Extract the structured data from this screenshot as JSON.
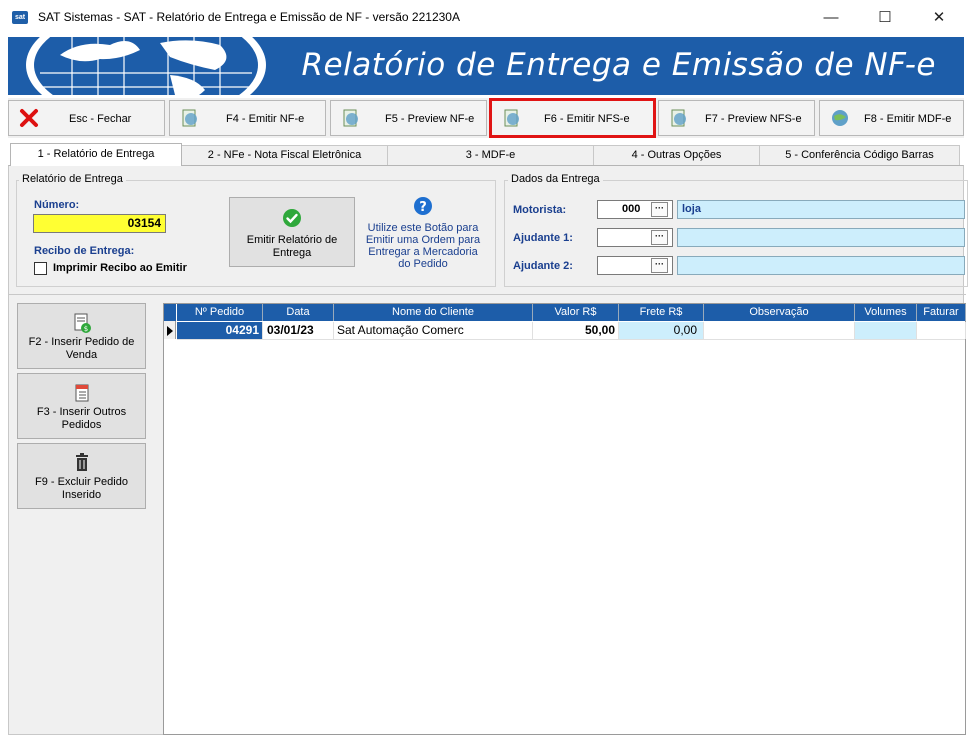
{
  "window": {
    "title": "SAT Sistemas - SAT - Relatório de Entrega e Emissão de NF - versão 221230A",
    "app_icon_text": "sat",
    "minimize": "—",
    "maximize": "☐",
    "close": "✕"
  },
  "banner": {
    "title": "Relatório de Entrega e Emissão de NF-e"
  },
  "toolbar": {
    "close": "Esc - Fechar",
    "emit_nfe": "F4 - Emitir NF-e",
    "preview_nfe": "F5 - Preview NF-e",
    "emit_nfse": "F6 - Emitir NFS-e",
    "preview_nfse": "F7 - Preview NFS-e",
    "emit_mdfe": "F8 - Emitir MDF-e"
  },
  "tabs": [
    "1 - Relatório de Entrega",
    "2 - NFe - Nota Fiscal Eletrônica",
    "3 - MDF-e",
    "4 - Outras Opções",
    "5 - Conferência Código Barras"
  ],
  "report": {
    "legend": "Relatório de Entrega",
    "number_label": "Número:",
    "number_value": "03154",
    "receipt_label": "Recibo de Entrega:",
    "print_receipt_label": "Imprimir Recibo ao Emitir",
    "emit_button_line1": "Emitir Relatório de",
    "emit_button_line2": "Entrega",
    "help_line1": "Utilize este Botão para",
    "help_line2": "Emitir uma Ordem para",
    "help_line3": "Entregar a Mercadoria",
    "help_line4": "do Pedido"
  },
  "delivery": {
    "legend": "Dados da Entrega",
    "driver_label": "Motorista:",
    "driver_code": "000",
    "driver_name": "loja",
    "helper1_label": "Ajudante 1:",
    "helper1_code": "",
    "helper1_name": "",
    "helper2_label": "Ajudante 2:",
    "helper2_code": "",
    "helper2_name": "",
    "dots": "···"
  },
  "side": {
    "insert_sale_line1": "F2 - Inserir Pedido de",
    "insert_sale_line2": "Venda",
    "insert_other_line1": "F3 - Inserir Outros",
    "insert_other_line2": "Pedidos",
    "delete_line1": "F9 - Excluir Pedido",
    "delete_line2": "Inserido"
  },
  "grid": {
    "columns": [
      "Nº Pedido",
      "Data",
      "Nome do Cliente",
      "Valor R$",
      "Frete R$",
      "Observação",
      "Volumes",
      "Faturar"
    ],
    "rows": [
      {
        "pedido": "04291",
        "data": "03/01/23",
        "cliente": "Sat Automação Comerc",
        "valor": "50,00",
        "frete": "0,00",
        "obs": "",
        "volumes": "",
        "faturar": ""
      }
    ]
  },
  "colors": {
    "accent": "#1d5da9",
    "number_bg": "#ffff33",
    "name_bg": "#cdeefc",
    "highlight": "#e01414",
    "check_green": "#2fa83b"
  }
}
